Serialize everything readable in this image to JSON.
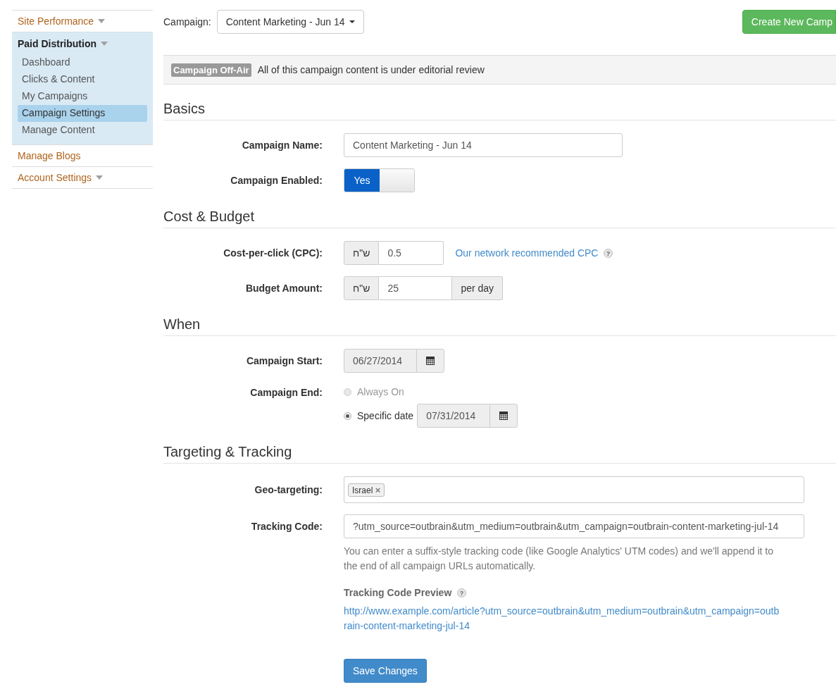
{
  "sidebar": {
    "sections": [
      {
        "label": "Site Performance",
        "dropdown": true,
        "expanded": false
      },
      {
        "label": "Paid Distribution",
        "dropdown": true,
        "expanded": true,
        "items": [
          {
            "label": "Dashboard",
            "selected": false
          },
          {
            "label": "Clicks & Content",
            "selected": false
          },
          {
            "label": "My Campaigns",
            "selected": false
          },
          {
            "label": "Campaign Settings",
            "selected": true
          },
          {
            "label": "Manage Content",
            "selected": false
          }
        ]
      },
      {
        "label": "Manage Blogs",
        "dropdown": false,
        "expanded": false
      },
      {
        "label": "Account Settings",
        "dropdown": true,
        "expanded": false
      }
    ]
  },
  "header": {
    "campaign_label": "Campaign:",
    "campaign_select": "Content Marketing - Jun 14",
    "create_button": "Create New Camp"
  },
  "alert": {
    "badge": "Campaign Off-Air",
    "message": "All of this campaign content is under editorial review"
  },
  "basics": {
    "heading": "Basics",
    "name_label": "Campaign Name:",
    "name_value": "Content Marketing - Jun 14",
    "enabled_label": "Campaign Enabled:",
    "enabled": {
      "on": true,
      "label": "Yes"
    }
  },
  "cost": {
    "heading": "Cost & Budget",
    "cpc_label": "Cost-per-click (CPC):",
    "cpc_currency": "ש\"ח",
    "cpc_value": "0.5",
    "cpc_link": "Our network recommended CPC",
    "cpc_help": "?",
    "budget_label": "Budget Amount:",
    "budget_currency": "ש\"ח",
    "budget_value": "25",
    "budget_suffix": "per day"
  },
  "when": {
    "heading": "When",
    "start_label": "Campaign Start:",
    "start_date": "06/27/2014",
    "end_label": "Campaign End:",
    "end_options": [
      {
        "label": "Always On",
        "selected": false,
        "disabled": true
      },
      {
        "label": "Specific date",
        "selected": true,
        "disabled": false,
        "date": "07/31/2014"
      }
    ]
  },
  "targeting": {
    "heading": "Targeting & Tracking",
    "geo_label": "Geo-targeting:",
    "geo_tags": [
      "Israel"
    ],
    "tag_remove": "×",
    "tracking_label": "Tracking Code:",
    "tracking_value": "?utm_source=outbrain&utm_medium=outbrain&utm_campaign=outbrain-content-marketing-jul-14",
    "help_text": "You can enter a suffix-style tracking code (like Google Analytics' UTM codes) and we'll append it to the end of all campaign URLs automatically.",
    "preview_title": "Tracking Code Preview",
    "preview_help": "?",
    "preview_url": "http://www.example.com/article?utm_source=outbrain&utm_medium=outbrain&utm_campaign=outbrain-content-marketing-jul-14"
  },
  "save_button": "Save Changes"
}
